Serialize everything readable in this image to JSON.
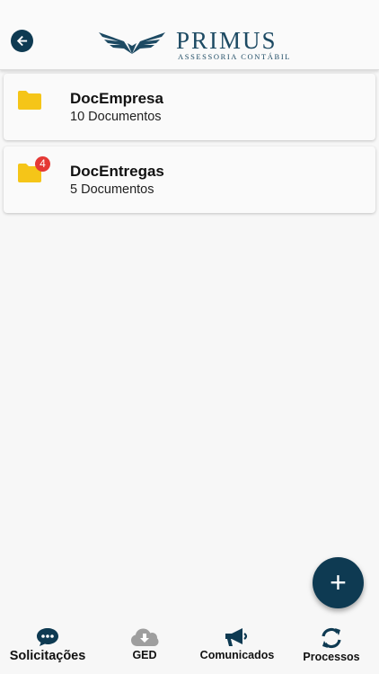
{
  "header": {
    "back_icon": "arrow-left-circle-icon",
    "logo_name": "PRIMUS",
    "logo_subtitle": "ASSESSORIA CONTÁBIL"
  },
  "folders": [
    {
      "title": "DocEmpresa",
      "subtitle": "10 Documentos",
      "badge": ""
    },
    {
      "title": "DocEntregas",
      "subtitle": "5 Documentos",
      "badge": "4"
    }
  ],
  "fab": {
    "label": "+"
  },
  "nav": [
    {
      "label": "Solicitações",
      "icon": "chat-bubble-icon",
      "active": true
    },
    {
      "label": "GED",
      "icon": "cloud-download-icon",
      "active": false
    },
    {
      "label": "Comunicados",
      "icon": "megaphone-icon",
      "active": false
    },
    {
      "label": "Processos",
      "icon": "sync-icon",
      "active": false
    }
  ],
  "colors": {
    "primary": "#0e3a52",
    "folder": "#f5c518",
    "badge": "#e53935",
    "inactive_icon": "#9e9e9e"
  }
}
